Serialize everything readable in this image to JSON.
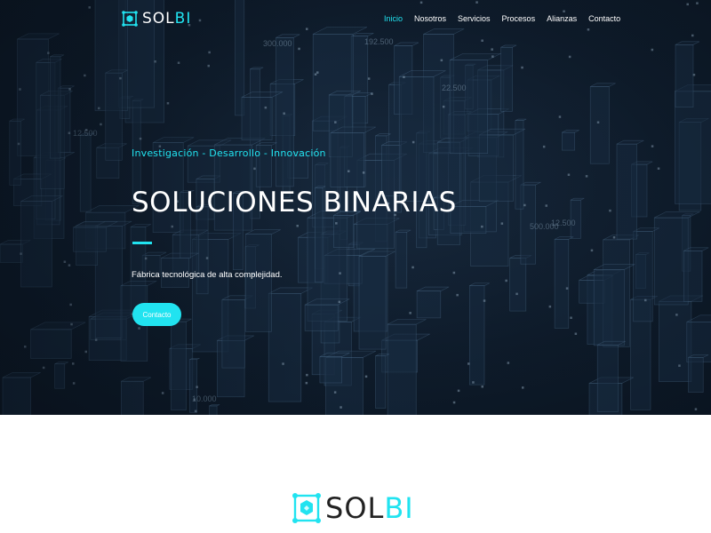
{
  "colors": {
    "accent": "#21e3f0",
    "hero_bg": "#0f1d2d",
    "text_light": "#ffffff",
    "text_dark": "#222222"
  },
  "brand": {
    "name_main": "SOL",
    "name_accent": "BI",
    "icon": "solbi-logo-icon"
  },
  "nav": {
    "items": [
      {
        "label": "Inicio",
        "active": true
      },
      {
        "label": "Nosotros",
        "active": false
      },
      {
        "label": "Servicios",
        "active": false
      },
      {
        "label": "Procesos",
        "active": false
      },
      {
        "label": "Alianzas",
        "active": false
      },
      {
        "label": "Contacto",
        "active": false
      }
    ]
  },
  "hero": {
    "tagline": "Investigación - Desarrollo - Innovación",
    "title": "SOLUCIONES BINARIAS",
    "subtitle": "Fábrica tecnológica de alta complejidad.",
    "cta_label": "Contacto",
    "background_labels": [
      "192.500",
      "22.500",
      "12.500",
      "300.000",
      "500.000",
      "10.000",
      "12.500"
    ]
  },
  "footer": {
    "logo_main": "SOL",
    "logo_accent": "BI",
    "icon": "solbi-logo-icon"
  }
}
